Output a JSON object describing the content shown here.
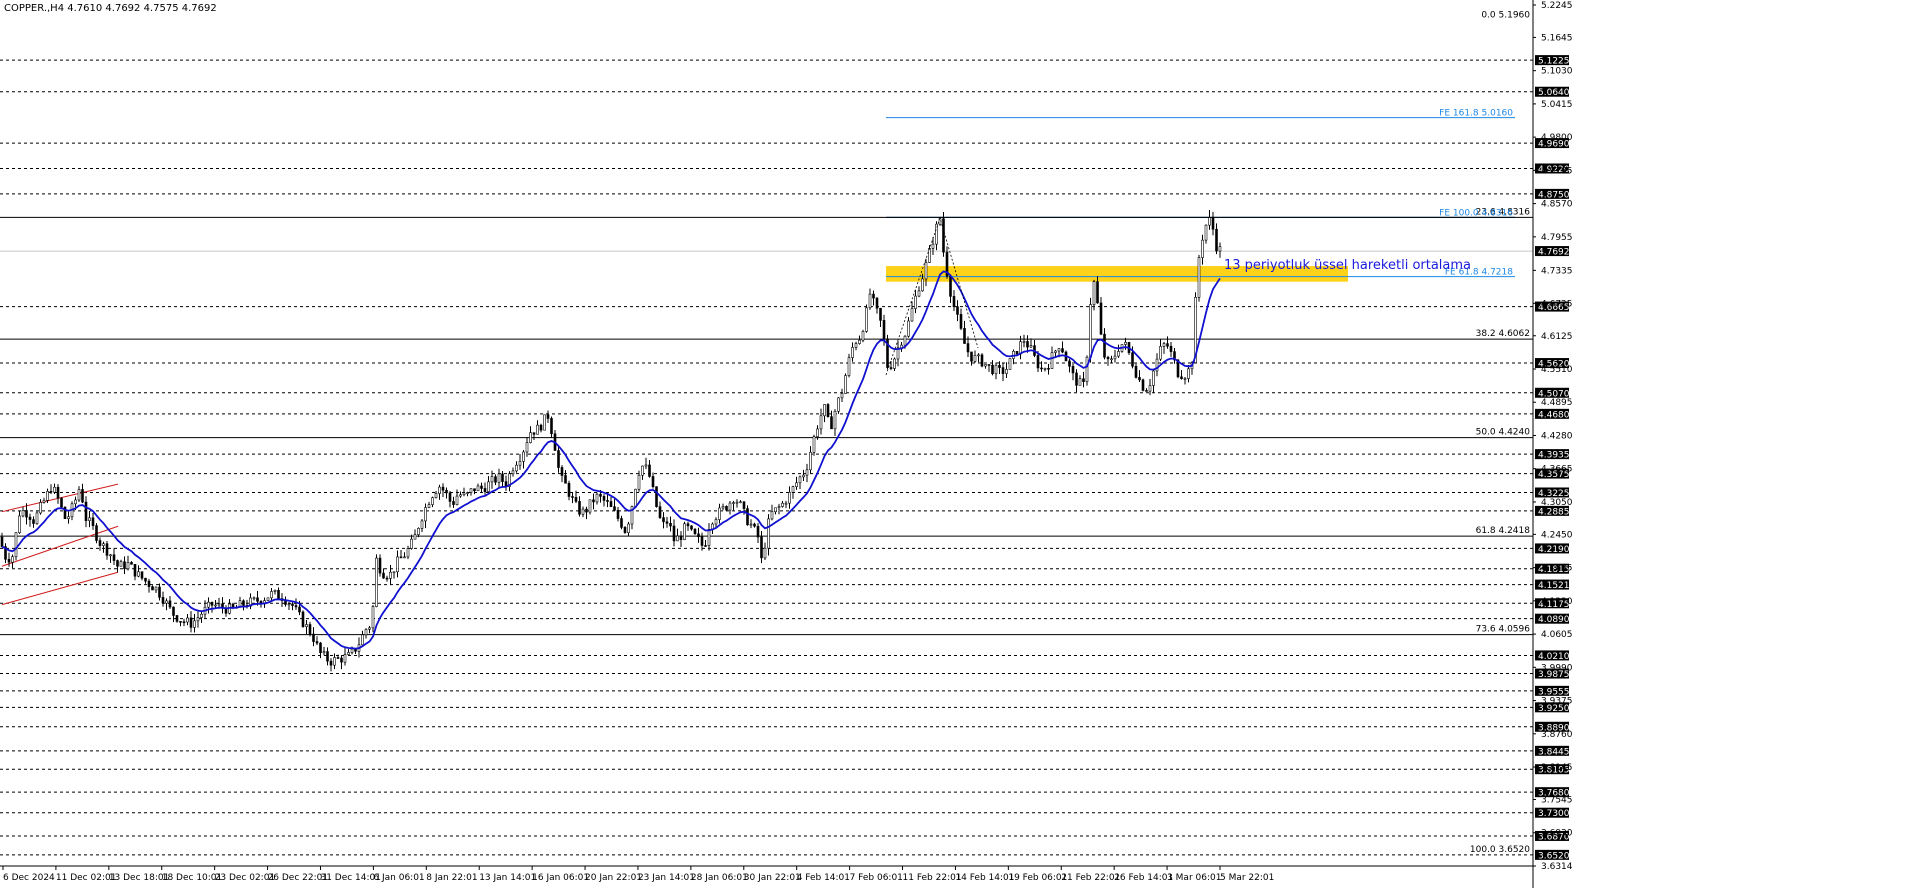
{
  "chart_data": {
    "type": "candlestick",
    "symbol_header": "COPPER.,H4  4.7610 4.7692 4.7575 4.7692",
    "current_price": "4.7692",
    "price_range": [
      3.6314,
      5.2245
    ],
    "y_tick_labels": [
      "5.2245",
      "5.1645",
      "5.1030",
      "5.0415",
      "4.9800",
      "4.9185",
      "4.8570",
      "4.7955",
      "4.7335",
      "4.6725",
      "4.6125",
      "4.5510",
      "4.4895",
      "4.4280",
      "4.3665",
      "4.3050",
      "4.2450",
      "4.1835",
      "4.1220",
      "4.0605",
      "3.9990",
      "3.9375",
      "3.8760",
      "3.8145",
      "3.7545",
      "3.6930",
      "3.6314"
    ],
    "price_badges": [
      "5.1225",
      "5.0640",
      "4.9690",
      "4.9220",
      "4.8750",
      "4.7692",
      "4.6665",
      "4.5620",
      "4.5070",
      "4.4680",
      "4.3935",
      "4.3575",
      "4.3225",
      "4.2885",
      "4.2190",
      "4.1815",
      "4.1521",
      "4.1175",
      "4.0890",
      "4.0210",
      "3.9875",
      "3.9555",
      "3.9250",
      "3.8890",
      "3.8445",
      "3.8105",
      "3.7680",
      "3.7300",
      "3.6870",
      "3.6520"
    ],
    "x_tick_labels": [
      "6 Dec 2024",
      "11 Dec 02:01",
      "13 Dec 18:01",
      "18 Dec 10:01",
      "23 Dec 02:01",
      "26 Dec 22:01",
      "31 Dec 14:01",
      "6 Jan 06:01",
      "8 Jan 22:01",
      "13 Jan 14:01",
      "16 Jan 06:01",
      "20 Jan 22:01",
      "23 Jan 14:01",
      "28 Jan 06:01",
      "30 Jan 22:01",
      "4 Feb 14:01",
      "7 Feb 06:01",
      "11 Feb 22:01",
      "14 Feb 14:01",
      "19 Feb 06:01",
      "21 Feb 22:01",
      "26 Feb 14:01",
      "3 Mar 06:01",
      "5 Mar 22:01"
    ],
    "fib_retracement": [
      {
        "label": "0.0 5.1960",
        "price": 5.196
      },
      {
        "label": "23.6 4.8316",
        "price": 4.8316
      },
      {
        "label": "38.2 4.6062",
        "price": 4.6062
      },
      {
        "label": "50.0 4.4240",
        "price": 4.424
      },
      {
        "label": "61.8 4.2418",
        "price": 4.2418
      },
      {
        "label": "73.6 4.0596",
        "price": 4.0596
      },
      {
        "label": "100.0 3.6520",
        "price": 3.652
      }
    ],
    "fib_expansion": [
      {
        "label": "FE 161.8 5.0160",
        "price": 5.016
      },
      {
        "label": "FE 100.0 4.8316",
        "price": 4.8316
      },
      {
        "label": "FE 61.8 4.7218",
        "price": 4.7218
      }
    ],
    "resistance_zone": [
      4.7125,
      4.7415
    ],
    "annotation": "13 periyotluk üssel hareketli ortalama",
    "price_path": [
      [
        0,
        4.24
      ],
      [
        4,
        4.205
      ],
      [
        12,
        4.2
      ],
      [
        20,
        4.29
      ],
      [
        28,
        4.285
      ],
      [
        34,
        4.27
      ],
      [
        42,
        4.3
      ],
      [
        52,
        4.335
      ],
      [
        58,
        4.31
      ],
      [
        66,
        4.27
      ],
      [
        74,
        4.3
      ],
      [
        80,
        4.335
      ],
      [
        86,
        4.275
      ],
      [
        92,
        4.26
      ],
      [
        100,
        4.23
      ],
      [
        110,
        4.21
      ],
      [
        118,
        4.185
      ],
      [
        128,
        4.19
      ],
      [
        138,
        4.17
      ],
      [
        148,
        4.155
      ],
      [
        156,
        4.145
      ],
      [
        164,
        4.125
      ],
      [
        172,
        4.1
      ],
      [
        182,
        4.085
      ],
      [
        192,
        4.08
      ],
      [
        202,
        4.1
      ],
      [
        212,
        4.115
      ],
      [
        222,
        4.11
      ],
      [
        232,
        4.105
      ],
      [
        242,
        4.115
      ],
      [
        252,
        4.12
      ],
      [
        262,
        4.125
      ],
      [
        272,
        4.135
      ],
      [
        282,
        4.13
      ],
      [
        292,
        4.115
      ],
      [
        302,
        4.085
      ],
      [
        312,
        4.06
      ],
      [
        320,
        4.025
      ],
      [
        330,
        4.01
      ],
      [
        340,
        4.015
      ],
      [
        350,
        4.02
      ],
      [
        358,
        4.04
      ],
      [
        366,
        4.07
      ],
      [
        372,
        4.08
      ],
      [
        376,
        4.2
      ],
      [
        382,
        4.175
      ],
      [
        390,
        4.17
      ],
      [
        398,
        4.195
      ],
      [
        406,
        4.21
      ],
      [
        414,
        4.235
      ],
      [
        420,
        4.27
      ],
      [
        428,
        4.305
      ],
      [
        434,
        4.325
      ],
      [
        440,
        4.335
      ],
      [
        446,
        4.32
      ],
      [
        452,
        4.3
      ],
      [
        458,
        4.32
      ],
      [
        466,
        4.315
      ],
      [
        474,
        4.33
      ],
      [
        482,
        4.33
      ],
      [
        490,
        4.34
      ],
      [
        498,
        4.35
      ],
      [
        506,
        4.34
      ],
      [
        514,
        4.375
      ],
      [
        522,
        4.395
      ],
      [
        530,
        4.435
      ],
      [
        538,
        4.44
      ],
      [
        544,
        4.455
      ],
      [
        548,
        4.465
      ],
      [
        554,
        4.42
      ],
      [
        560,
        4.35
      ],
      [
        566,
        4.335
      ],
      [
        572,
        4.31
      ],
      [
        578,
        4.29
      ],
      [
        584,
        4.285
      ],
      [
        590,
        4.3
      ],
      [
        596,
        4.315
      ],
      [
        602,
        4.31
      ],
      [
        608,
        4.3
      ],
      [
        614,
        4.285
      ],
      [
        620,
        4.27
      ],
      [
        626,
        4.25
      ],
      [
        632,
        4.3
      ],
      [
        638,
        4.36
      ],
      [
        644,
        4.375
      ],
      [
        650,
        4.35
      ],
      [
        656,
        4.3
      ],
      [
        662,
        4.26
      ],
      [
        668,
        4.27
      ],
      [
        674,
        4.235
      ],
      [
        680,
        4.24
      ],
      [
        686,
        4.26
      ],
      [
        692,
        4.245
      ],
      [
        698,
        4.235
      ],
      [
        704,
        4.22
      ],
      [
        710,
        4.27
      ],
      [
        716,
        4.28
      ],
      [
        722,
        4.29
      ],
      [
        728,
        4.3
      ],
      [
        734,
        4.315
      ],
      [
        740,
        4.3
      ],
      [
        746,
        4.275
      ],
      [
        752,
        4.26
      ],
      [
        758,
        4.24
      ],
      [
        762,
        4.19
      ],
      [
        766,
        4.24
      ],
      [
        770,
        4.28
      ],
      [
        776,
        4.29
      ],
      [
        782,
        4.3
      ],
      [
        790,
        4.32
      ],
      [
        798,
        4.345
      ],
      [
        806,
        4.365
      ],
      [
        812,
        4.41
      ],
      [
        818,
        4.45
      ],
      [
        824,
        4.48
      ],
      [
        830,
        4.44
      ],
      [
        836,
        4.48
      ],
      [
        842,
        4.51
      ],
      [
        848,
        4.56
      ],
      [
        854,
        4.6
      ],
      [
        860,
        4.61
      ],
      [
        866,
        4.65
      ],
      [
        870,
        4.69
      ],
      [
        876,
        4.66
      ],
      [
        882,
        4.63
      ],
      [
        888,
        4.55
      ],
      [
        894,
        4.57
      ],
      [
        900,
        4.6
      ],
      [
        906,
        4.62
      ],
      [
        912,
        4.66
      ],
      [
        918,
        4.7
      ],
      [
        924,
        4.73
      ],
      [
        930,
        4.77
      ],
      [
        936,
        4.81
      ],
      [
        940,
        4.83
      ],
      [
        944,
        4.76
      ],
      [
        948,
        4.72
      ],
      [
        952,
        4.68
      ],
      [
        958,
        4.64
      ],
      [
        964,
        4.6
      ],
      [
        970,
        4.575
      ],
      [
        976,
        4.57
      ],
      [
        982,
        4.565
      ],
      [
        988,
        4.555
      ],
      [
        994,
        4.55
      ],
      [
        1000,
        4.545
      ],
      [
        1006,
        4.55
      ],
      [
        1012,
        4.57
      ],
      [
        1018,
        4.59
      ],
      [
        1024,
        4.605
      ],
      [
        1030,
        4.59
      ],
      [
        1036,
        4.565
      ],
      [
        1042,
        4.55
      ],
      [
        1048,
        4.56
      ],
      [
        1054,
        4.58
      ],
      [
        1060,
        4.6
      ],
      [
        1066,
        4.57
      ],
      [
        1072,
        4.54
      ],
      [
        1078,
        4.525
      ],
      [
        1084,
        4.52
      ],
      [
        1088,
        4.6
      ],
      [
        1092,
        4.72
      ],
      [
        1096,
        4.7
      ],
      [
        1100,
        4.62
      ],
      [
        1106,
        4.56
      ],
      [
        1112,
        4.565
      ],
      [
        1118,
        4.59
      ],
      [
        1124,
        4.6
      ],
      [
        1130,
        4.575
      ],
      [
        1136,
        4.545
      ],
      [
        1142,
        4.52
      ],
      [
        1148,
        4.515
      ],
      [
        1154,
        4.55
      ],
      [
        1160,
        4.585
      ],
      [
        1166,
        4.6
      ],
      [
        1172,
        4.575
      ],
      [
        1178,
        4.545
      ],
      [
        1184,
        4.54
      ],
      [
        1188,
        4.545
      ],
      [
        1192,
        4.57
      ],
      [
        1196,
        4.69
      ],
      [
        1200,
        4.78
      ],
      [
        1204,
        4.805
      ],
      [
        1208,
        4.83
      ],
      [
        1212,
        4.82
      ],
      [
        1216,
        4.78
      ],
      [
        1221,
        4.7692
      ]
    ]
  }
}
